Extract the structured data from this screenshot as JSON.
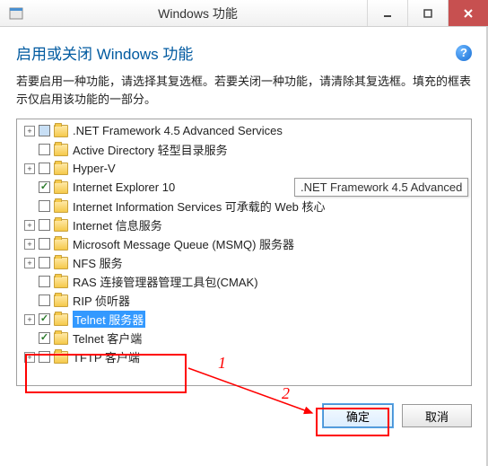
{
  "window": {
    "title": "Windows 功能"
  },
  "heading": "启用或关闭 Windows 功能",
  "description": "若要启用一种功能，请选择其复选框。若要关闭一种功能，请清除其复选框。填充的框表示仅启用该功能的一部分。",
  "tooltip": ".NET Framework 4.5 Advanced",
  "items": [
    {
      "exp": "+",
      "chk": "filled",
      "label": ".NET Framework 4.5 Advanced Services"
    },
    {
      "exp": "",
      "chk": "",
      "label": "Active Directory 轻型目录服务"
    },
    {
      "exp": "+",
      "chk": "",
      "label": "Hyper-V"
    },
    {
      "exp": "",
      "chk": "checked",
      "label": "Internet Explorer 10"
    },
    {
      "exp": "",
      "chk": "",
      "label": "Internet Information Services 可承载的 Web 核心"
    },
    {
      "exp": "+",
      "chk": "",
      "label": "Internet 信息服务"
    },
    {
      "exp": "+",
      "chk": "",
      "label": "Microsoft Message Queue (MSMQ) 服务器"
    },
    {
      "exp": "+",
      "chk": "",
      "label": "NFS 服务"
    },
    {
      "exp": "",
      "chk": "",
      "label": "RAS 连接管理器管理工具包(CMAK)"
    },
    {
      "exp": "",
      "chk": "",
      "label": "RIP 侦听器"
    },
    {
      "exp": "+",
      "chk": "checked",
      "label": "Telnet 服务器",
      "selected": true
    },
    {
      "exp": "",
      "chk": "checked",
      "label": "Telnet 客户端"
    },
    {
      "exp": "+",
      "chk": "",
      "label": "TFTP 客户端"
    }
  ],
  "buttons": {
    "ok": "确定",
    "cancel": "取消"
  },
  "annotations": {
    "one": "1",
    "two": "2"
  }
}
